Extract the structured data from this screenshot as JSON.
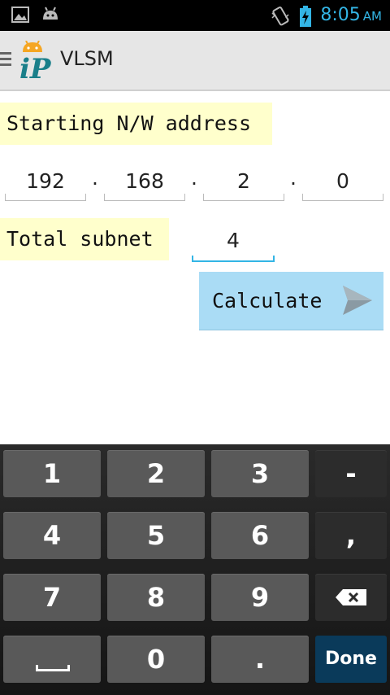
{
  "status_bar": {
    "time": "8:05",
    "ampm": "AM",
    "icons": [
      "image-icon",
      "android-icon",
      "vibrate-icon",
      "battery-charging-icon"
    ],
    "accent": "#33b5e5"
  },
  "action_bar": {
    "title": "VLSM",
    "logo_text": "iP",
    "background": "#e6e6e6"
  },
  "form": {
    "starting_label": "Starting N/W address",
    "ip_octets": [
      "192",
      "168",
      "2",
      "0"
    ],
    "separator": ".",
    "total_subnet_label": "Total subnet",
    "total_subnet_value": "4",
    "label_bg": "#ffffcc"
  },
  "calculate_button": {
    "label": "Calculate",
    "icon": "send-arrow-icon",
    "background": "#aadcf5"
  },
  "keyboard": {
    "rows": [
      [
        "1",
        "2",
        "3",
        "-"
      ],
      [
        "4",
        "5",
        "6",
        ","
      ],
      [
        "7",
        "8",
        "9",
        "⌫"
      ],
      [
        "␣",
        "0",
        ".",
        "Done"
      ]
    ],
    "done_label": "Done"
  }
}
